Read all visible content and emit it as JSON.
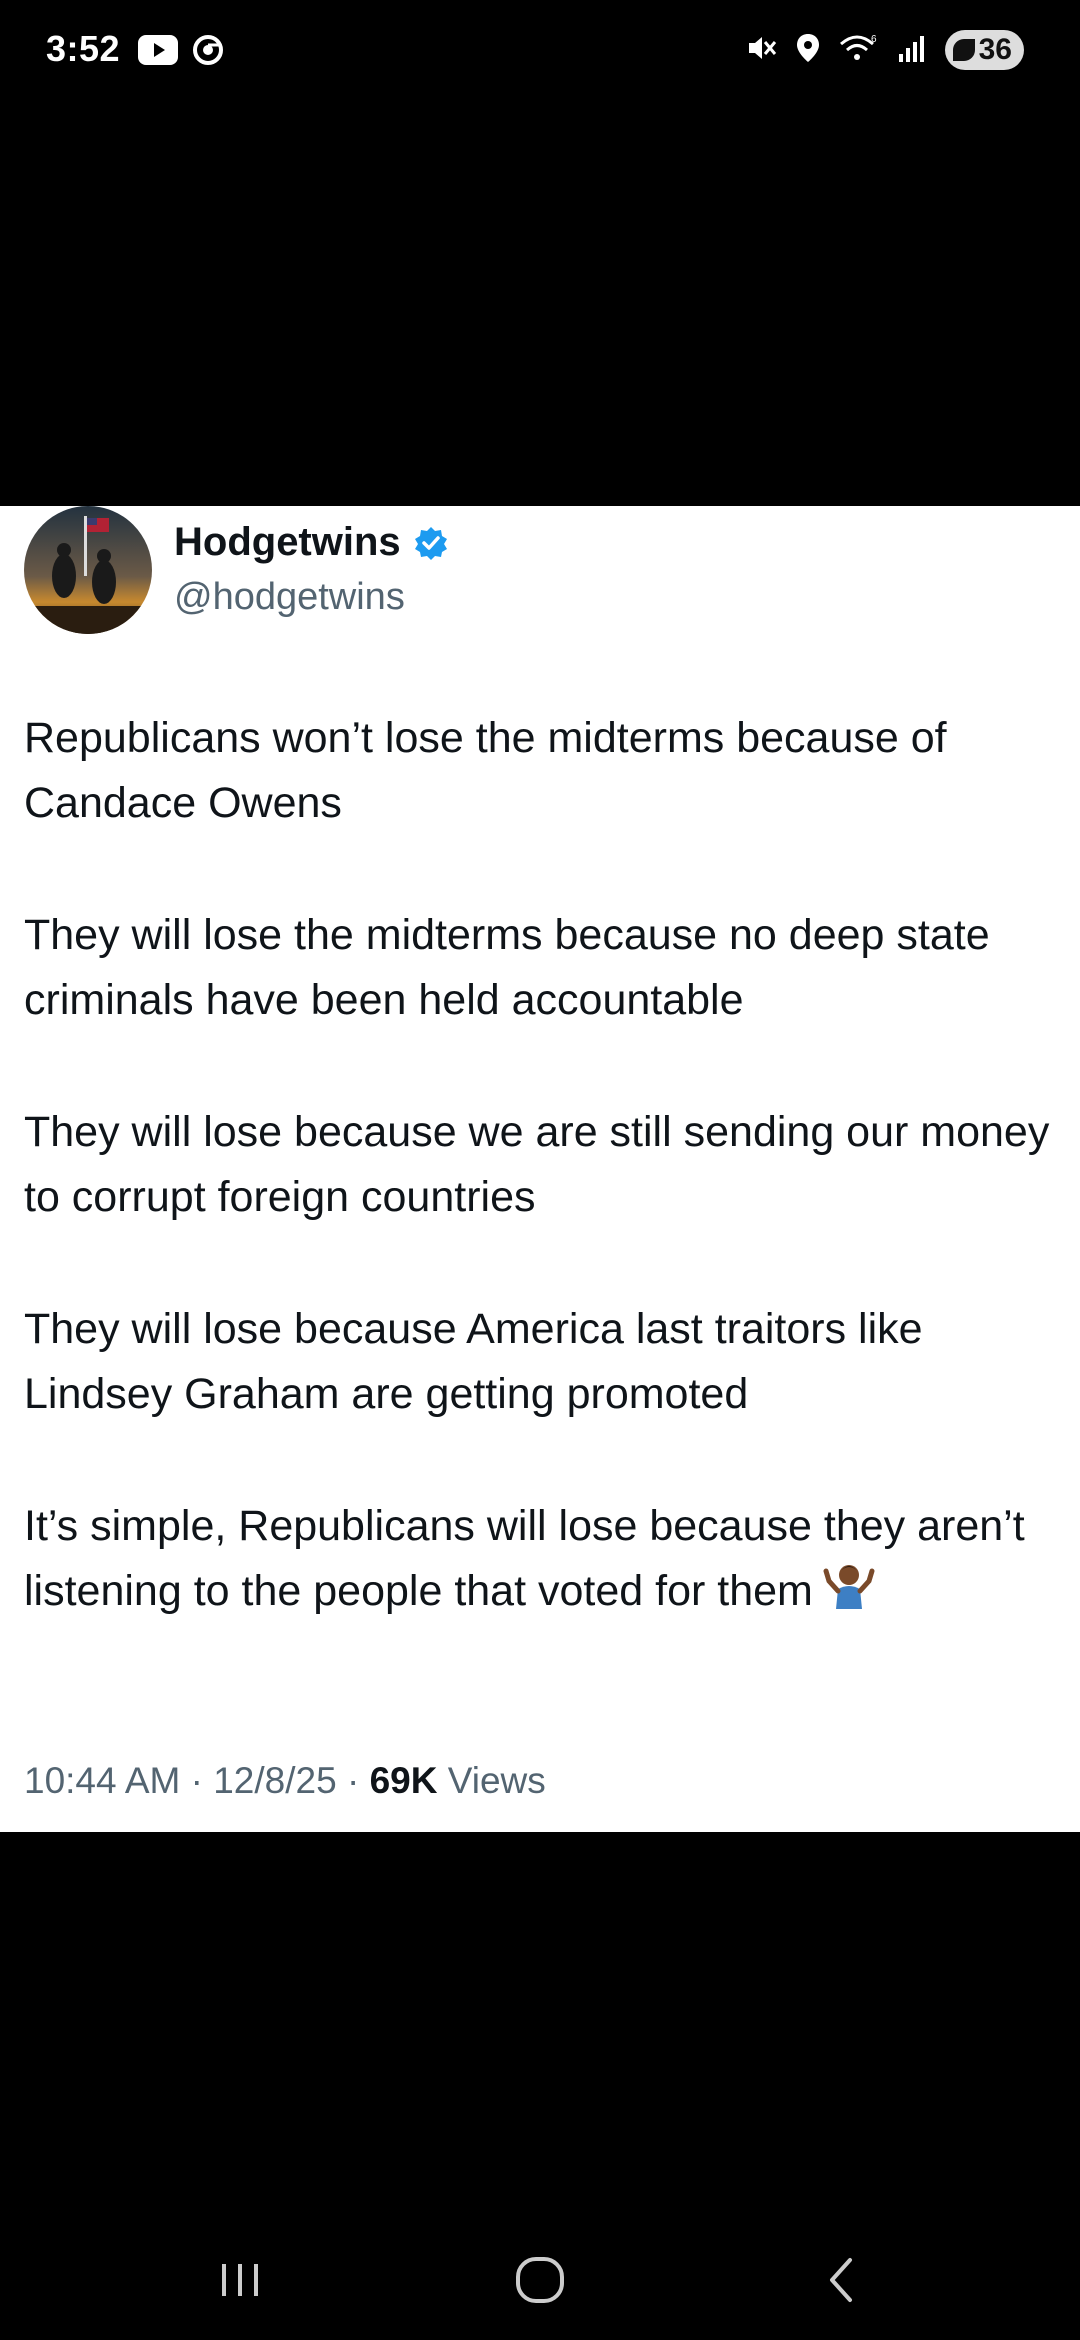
{
  "status_bar": {
    "time": "3:52",
    "battery": "36",
    "icons": [
      "youtube-icon",
      "chrome-icon",
      "mute-icon",
      "location-icon",
      "wifi-icon",
      "signal-icon",
      "battery-icon"
    ]
  },
  "tweet": {
    "author_name": "Hodgetwins",
    "author_handle": "@hodgetwins",
    "verified": true,
    "paragraphs": [
      "Republicans won’t lose the midterms because of Candace Owens",
      "They will lose the midterms because no deep state criminals have been held accountable",
      "They will lose because we are still sending our money to corrupt foreign countries",
      "They will lose because America last traitors like Lindsey Graham are getting promoted",
      "It’s simple, Republicans will lose because they aren’t listening to the people that voted for them"
    ],
    "time": "10:44 AM",
    "separator": "·",
    "date": "12/8/25",
    "views_count": "69K",
    "views_label": "Views"
  },
  "nav_bar": {
    "buttons": [
      "recents-icon",
      "home-icon",
      "back-icon"
    ]
  },
  "colors": {
    "background": "#000000",
    "card": "#ffffff",
    "text_primary": "#0f1419",
    "text_secondary": "#536471",
    "verified": "#1d9bf0"
  }
}
